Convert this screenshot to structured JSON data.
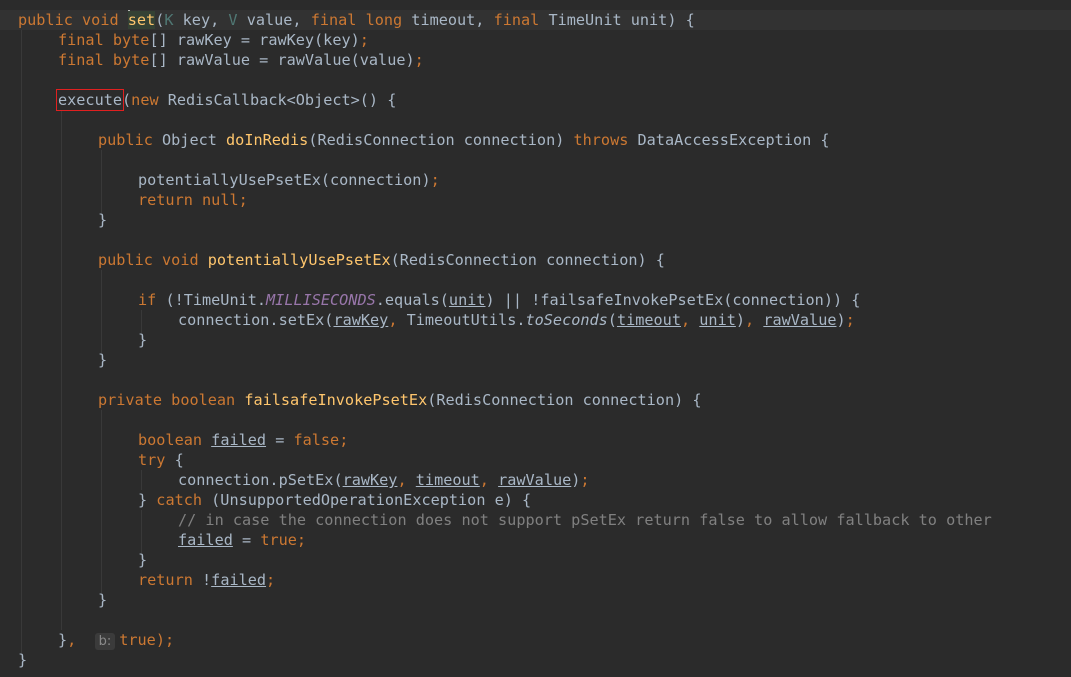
{
  "code": {
    "line1": {
      "public": "public",
      "void": "void",
      "set": "set",
      "lparen": "(",
      "K": "K",
      "key": " key, ",
      "V": "V",
      "value": " value, ",
      "final1": "final",
      "long": "long",
      "timeout": " timeout, ",
      "final2": "final",
      "rest": " TimeUnit unit) {"
    },
    "line2": {
      "final": "final",
      "byte": "byte",
      "rest": "[] rawKey = rawKey(key)",
      "semi": ";"
    },
    "line3": {
      "final": "final",
      "byte": "byte",
      "rest": "[] rawValue = rawValue(value)",
      "semi": ";"
    },
    "line5": {
      "execute": "execute",
      "lparen": "(",
      "new": "new",
      "rest": " RedisCallback<Object>() {"
    },
    "line7": {
      "public": "public",
      "object": " Object ",
      "method": "doInRedis",
      "params": "(RedisConnection connection) ",
      "throws": "throws",
      "rest": " DataAccessException {"
    },
    "line9": {
      "text": "potentiallyUsePsetEx(connection)",
      "semi": ";"
    },
    "line10": {
      "return": "return",
      "null": "null",
      "semi": ";"
    },
    "line11": {
      "text": "}"
    },
    "line13": {
      "public": "public",
      "void": "void",
      "method": "potentiallyUsePsetEx",
      "rest": "(RedisConnection connection) {"
    },
    "line15": {
      "if": "if",
      "a": " (!TimeUnit.",
      "millis": "MILLISECONDS",
      "b": ".equals(",
      "unit": "unit",
      "c": ") || !failsafeInvokePsetEx(connection)) {"
    },
    "line16": {
      "a": "connection.setEx(",
      "rawKey": "rawKey",
      "comma1": ",",
      "b": " TimeoutUtils.",
      "toSeconds": "toSeconds",
      "c": "(",
      "timeout": "timeout",
      "comma2": ",",
      "unit": "unit",
      "d": ")",
      "comma3": ",",
      "rawValue": "rawValue",
      "e": ")",
      "semi": ";"
    },
    "line17": {
      "text": "}"
    },
    "line18": {
      "text": "}"
    },
    "line20": {
      "private": "private",
      "boolean": "boolean",
      "method": "failsafeInvokePsetEx",
      "rest": "(RedisConnection connection) {"
    },
    "line22": {
      "boolean": "boolean",
      "failed": "failed",
      "eq": " = ",
      "false": "false",
      "semi": ";"
    },
    "line23": {
      "try": "try",
      "rest": " {"
    },
    "line24": {
      "a": "connection.pSetEx(",
      "rawKey": "rawKey",
      "comma1": ",",
      "timeout": "timeout",
      "comma2": ",",
      "rawValue": "rawValue",
      "b": ")",
      "semi": ";"
    },
    "line25": {
      "a": "} ",
      "catch": "catch",
      "rest": " (UnsupportedOperationException e) {"
    },
    "line26": {
      "comment": "// in case the connection does not support pSetEx return false to allow fallback to other"
    },
    "line27": {
      "failed": "failed",
      "eq": " = ",
      "true": "true",
      "semi": ";"
    },
    "line28": {
      "text": "}"
    },
    "line29": {
      "return": "return",
      "a": " !",
      "failed": "failed",
      "semi": ";"
    },
    "line30": {
      "text": "}"
    },
    "line32": {
      "close": "}",
      "comma": ",",
      "hint": "b:",
      "true": "true",
      "end": ");"
    },
    "line33": {
      "text": "}"
    }
  }
}
